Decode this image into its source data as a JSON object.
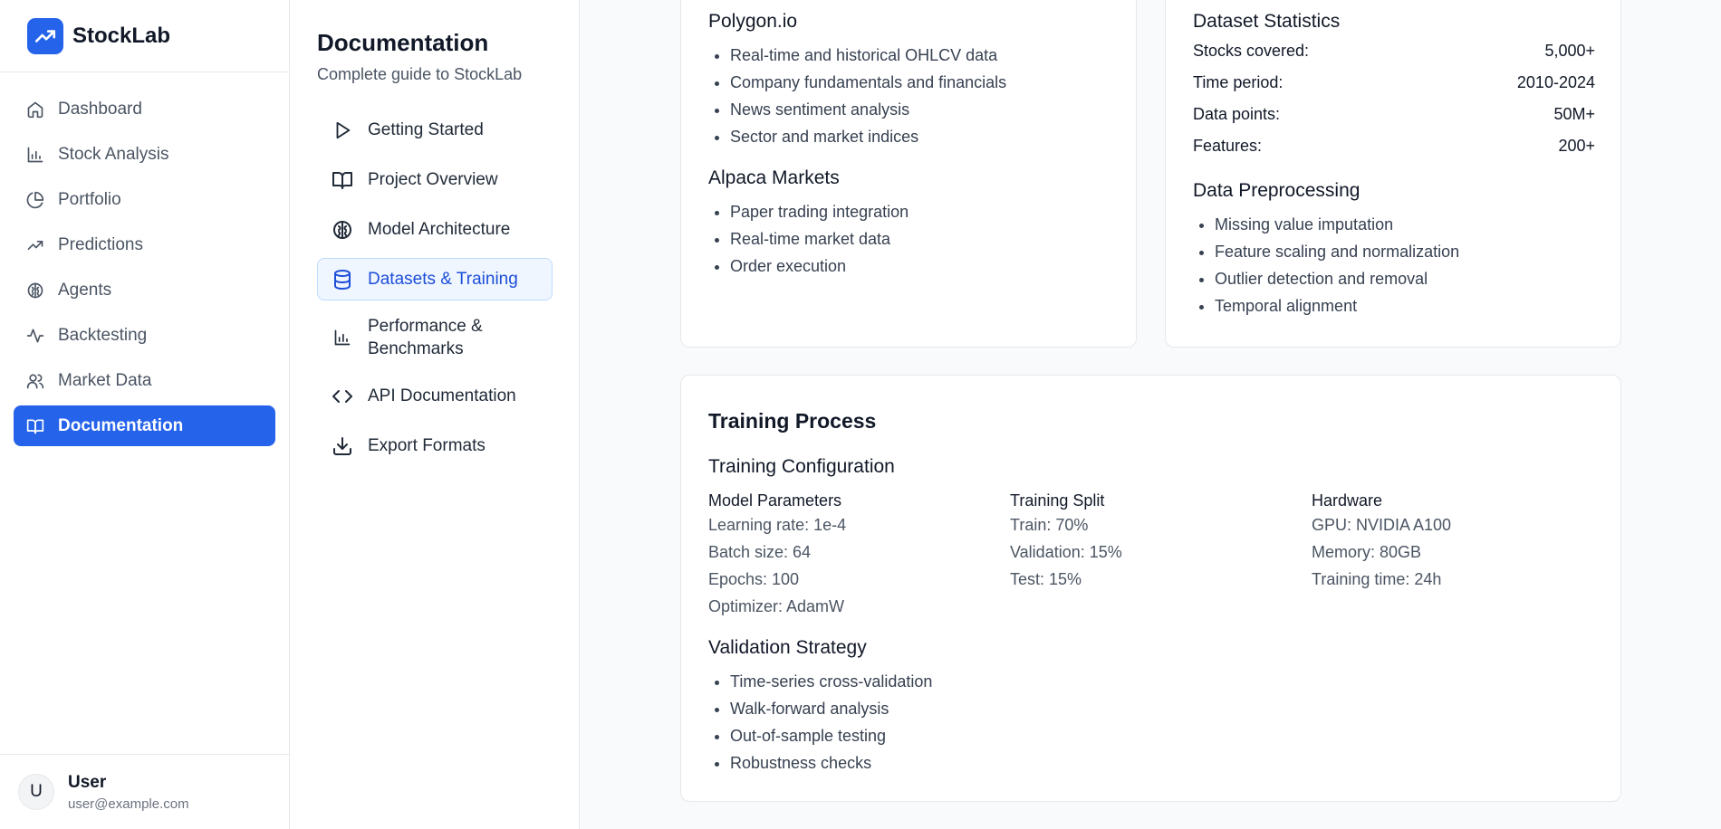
{
  "app": {
    "name": "StockLab"
  },
  "nav": {
    "items": [
      {
        "label": "Dashboard",
        "icon": "home-icon"
      },
      {
        "label": "Stock Analysis",
        "icon": "bar-chart-icon"
      },
      {
        "label": "Portfolio",
        "icon": "pie-chart-icon"
      },
      {
        "label": "Predictions",
        "icon": "trending-up-icon"
      },
      {
        "label": "Agents",
        "icon": "brain-icon"
      },
      {
        "label": "Backtesting",
        "icon": "activity-icon"
      },
      {
        "label": "Market Data",
        "icon": "users-icon"
      },
      {
        "label": "Documentation",
        "icon": "book-icon",
        "active": true
      }
    ]
  },
  "user": {
    "initial": "U",
    "name": "User",
    "email": "user@example.com"
  },
  "docs": {
    "title": "Documentation",
    "subtitle": "Complete guide to StockLab",
    "items": [
      {
        "label": "Getting Started",
        "icon": "play-icon"
      },
      {
        "label": "Project Overview",
        "icon": "book-open-icon"
      },
      {
        "label": "Model Architecture",
        "icon": "brain-icon"
      },
      {
        "label": "Datasets & Training",
        "icon": "database-icon",
        "active": true
      },
      {
        "label": "Performance & Benchmarks",
        "icon": "bar-chart-icon"
      },
      {
        "label": "API Documentation",
        "icon": "code-icon"
      },
      {
        "label": "Export Formats",
        "icon": "download-icon"
      }
    ]
  },
  "sources": {
    "polygon": {
      "title": "Polygon.io",
      "items": [
        "Real-time and historical OHLCV data",
        "Company fundamentals and financials",
        "News sentiment analysis",
        "Sector and market indices"
      ]
    },
    "alpaca": {
      "title": "Alpaca Markets",
      "items": [
        "Paper trading integration",
        "Real-time market data",
        "Order execution"
      ]
    }
  },
  "stats": {
    "title": "Dataset Statistics",
    "rows": [
      {
        "label": "Stocks covered:",
        "value": "5,000+"
      },
      {
        "label": "Time period:",
        "value": "2010-2024"
      },
      {
        "label": "Data points:",
        "value": "50M+"
      },
      {
        "label": "Features:",
        "value": "200+"
      }
    ],
    "preprocessing": {
      "title": "Data Preprocessing",
      "items": [
        "Missing value imputation",
        "Feature scaling and normalization",
        "Outlier detection and removal",
        "Temporal alignment"
      ]
    }
  },
  "training": {
    "title": "Training Process",
    "config_title": "Training Configuration",
    "columns": [
      {
        "title": "Model Parameters",
        "lines": [
          "Learning rate: 1e-4",
          "Batch size: 64",
          "Epochs: 100",
          "Optimizer: AdamW"
        ]
      },
      {
        "title": "Training Split",
        "lines": [
          "Train: 70%",
          "Validation: 15%",
          "Test: 15%"
        ]
      },
      {
        "title": "Hardware",
        "lines": [
          "GPU: NVIDIA A100",
          "Memory: 80GB",
          "Training time: 24h"
        ]
      }
    ],
    "validation": {
      "title": "Validation Strategy",
      "items": [
        "Time-series cross-validation",
        "Walk-forward analysis",
        "Out-of-sample testing",
        "Robustness checks"
      ]
    }
  },
  "colors": {
    "primary": "#2563eb",
    "active_doc_bg": "#eff6ff",
    "active_doc_text": "#1d4ed8"
  }
}
